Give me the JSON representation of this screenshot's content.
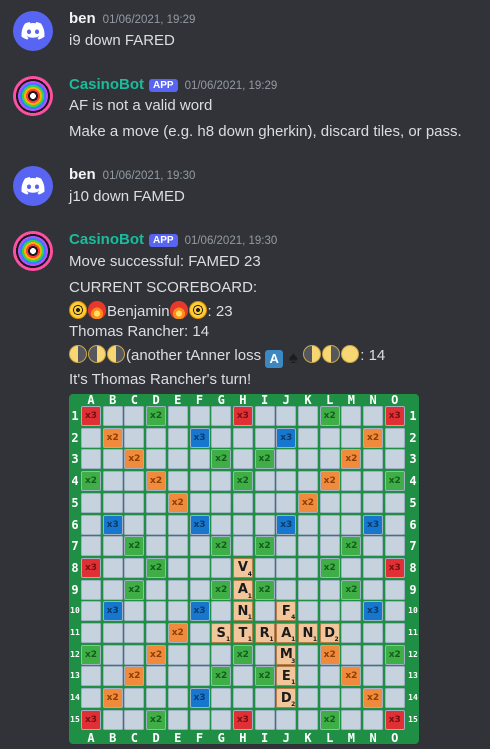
{
  "messages": [
    {
      "author": "ben",
      "bot": false,
      "timestamp": "01/06/2021, 19:29",
      "lines": [
        "i9 down FARED"
      ]
    },
    {
      "author": "CasinoBot",
      "bot": true,
      "app_tag": "APP",
      "timestamp": "01/06/2021, 19:29",
      "lines": [
        "AF is not a valid word",
        "Make a move (e.g. h8 down gherkin), discard tiles, or pass."
      ]
    },
    {
      "author": "ben",
      "bot": false,
      "timestamp": "01/06/2021, 19:30",
      "lines": [
        "j10 down FAMED"
      ]
    },
    {
      "author": "CasinoBot",
      "bot": true,
      "app_tag": "APP",
      "timestamp": "01/06/2021, 19:30",
      "move_result": "Move successful: FAMED 23",
      "scoreboard_header": "CURRENT SCOREBOARD:",
      "scores": [
        {
          "name": "Benjamin",
          "score": ": 23",
          "emoji_before": [
            "radioactive",
            "fire"
          ],
          "emoji_after": [
            "fire",
            "radioactive"
          ]
        },
        {
          "name": "Thomas Rancher: 14"
        },
        {
          "name": "(another tAnner loss",
          "score": ": 14",
          "emoji_before": [
            "moon",
            "moon-waning",
            "moon-waxing"
          ],
          "emoji_after": [
            "letter-a",
            "spade",
            "moon-waning",
            "moon-waxing",
            "full-moon"
          ]
        }
      ],
      "turn_text": "It's Thomas Rancher's turn!"
    }
  ],
  "board": {
    "columns": [
      "A",
      "B",
      "C",
      "D",
      "E",
      "F",
      "G",
      "H",
      "I",
      "J",
      "K",
      "L",
      "M",
      "N",
      "O"
    ],
    "rows": [
      "1",
      "2",
      "3",
      "4",
      "5",
      "6",
      "7",
      "8",
      "9",
      "10",
      "11",
      "12",
      "13",
      "14",
      "15"
    ],
    "premium_labels": {
      "tw": "x3",
      "dw": "x2",
      "tl": "x3",
      "dl": "x2"
    },
    "tiles": [
      {
        "letter": "V",
        "points": "4",
        "row": 8,
        "col": 8
      },
      {
        "letter": "A",
        "points": "1",
        "row": 9,
        "col": 8
      },
      {
        "letter": "N",
        "points": "1",
        "row": 10,
        "col": 8
      },
      {
        "letter": "S",
        "points": "1",
        "row": 11,
        "col": 7
      },
      {
        "letter": "T",
        "points": "1",
        "row": 11,
        "col": 8
      },
      {
        "letter": "R",
        "points": "1",
        "row": 11,
        "col": 9
      },
      {
        "letter": "A",
        "points": "1",
        "row": 11,
        "col": 10
      },
      {
        "letter": "N",
        "points": "1",
        "row": 11,
        "col": 11
      },
      {
        "letter": "D",
        "points": "2",
        "row": 11,
        "col": 12
      },
      {
        "letter": "F",
        "points": "4",
        "row": 10,
        "col": 10
      },
      {
        "letter": "M",
        "points": "3",
        "row": 12,
        "col": 10
      },
      {
        "letter": "E",
        "points": "1",
        "row": 13,
        "col": 10
      },
      {
        "letter": "D",
        "points": "2",
        "row": 14,
        "col": 10
      }
    ]
  }
}
